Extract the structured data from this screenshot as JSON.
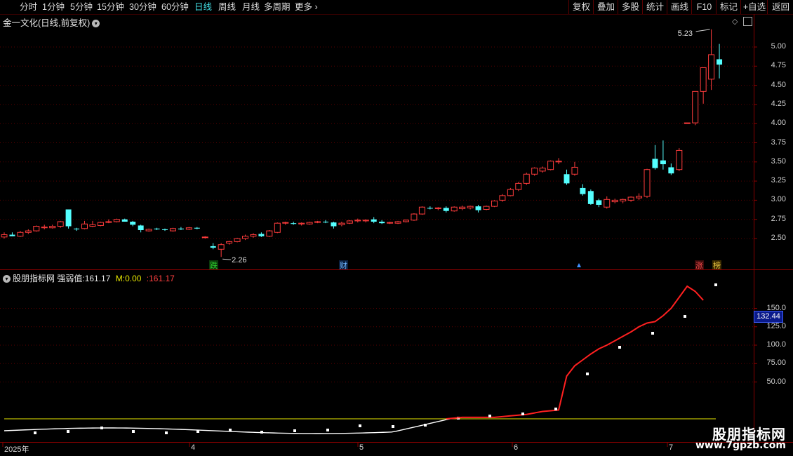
{
  "toolbar": {
    "periods": [
      "分时",
      "1分钟",
      "5分钟",
      "15分钟",
      "30分钟",
      "60分钟",
      "日线",
      "周线",
      "月线",
      "多周期",
      "更多"
    ],
    "active_period": "日线",
    "right_buttons": [
      "复权",
      "叠加",
      "多股",
      "统计",
      "画线",
      "F10",
      "标记",
      "+自选",
      "返回"
    ]
  },
  "chart_title": "金一文化(日线,前复权)",
  "main_yaxis": [
    "5.00",
    "4.75",
    "4.50",
    "4.25",
    "4.00",
    "3.75",
    "3.50",
    "3.25",
    "3.00",
    "2.75",
    "2.50"
  ],
  "high_label": "5.23",
  "low_label": "2.26",
  "markers": [
    {
      "text": "跌",
      "color": "#2fd12f",
      "bg": "#0b3a0b"
    },
    {
      "text": "财",
      "color": "#6fb5ff",
      "bg": "#0a2040"
    },
    {
      "text": "涨",
      "color": "#ff5050",
      "bg": "#3a0a0a"
    },
    {
      "text": "榜",
      "color": "#e6c040",
      "bg": "#3a2a00"
    }
  ],
  "indicator": {
    "name": "股朋指标网",
    "label": "强弱值:",
    "value": "161.17",
    "m_label": "M:",
    "m_value": "0.00",
    "extra": ":161.17",
    "yaxis": [
      "150.0",
      "125.0",
      "100.0",
      "75.00",
      "50.00"
    ],
    "badge": "132.44"
  },
  "xaxis": [
    "2025年",
    "4",
    "5",
    "6",
    "7"
  ],
  "watermark": {
    "line1": "股朋指标网",
    "line2": "www.7gpzb.com"
  },
  "colors": {
    "up": "#ff3c3c",
    "down": "#54ffff",
    "line": "#ff2020",
    "white_line": "#ffffff",
    "zero": "#e8e800"
  },
  "chart_data": {
    "type": "candlestick",
    "ohlc": [
      [
        2.52,
        2.58,
        2.5,
        2.55
      ],
      [
        2.55,
        2.58,
        2.53,
        2.53
      ],
      [
        2.53,
        2.6,
        2.52,
        2.58
      ],
      [
        2.58,
        2.62,
        2.56,
        2.6
      ],
      [
        2.6,
        2.67,
        2.59,
        2.66
      ],
      [
        2.64,
        2.68,
        2.62,
        2.65
      ],
      [
        2.64,
        2.68,
        2.63,
        2.66
      ],
      [
        2.66,
        2.73,
        2.64,
        2.72
      ],
      [
        2.88,
        2.88,
        2.63,
        2.66
      ],
      [
        2.63,
        2.64,
        2.6,
        2.62
      ],
      [
        2.63,
        2.73,
        2.62,
        2.69
      ],
      [
        2.66,
        2.73,
        2.65,
        2.68
      ],
      [
        2.67,
        2.72,
        2.66,
        2.71
      ],
      [
        2.71,
        2.75,
        2.7,
        2.72
      ],
      [
        2.72,
        2.76,
        2.71,
        2.75
      ],
      [
        2.75,
        2.76,
        2.72,
        2.72
      ],
      [
        2.72,
        2.73,
        2.66,
        2.68
      ],
      [
        2.67,
        2.68,
        2.58,
        2.61
      ],
      [
        2.6,
        2.63,
        2.59,
        2.62
      ],
      [
        2.63,
        2.64,
        2.61,
        2.62
      ],
      [
        2.62,
        2.63,
        2.6,
        2.61
      ],
      [
        2.6,
        2.64,
        2.59,
        2.63
      ],
      [
        2.63,
        2.65,
        2.61,
        2.62
      ],
      [
        2.62,
        2.65,
        2.61,
        2.64
      ],
      [
        2.64,
        2.65,
        2.62,
        2.63
      ],
      [
        2.52,
        2.53,
        2.5,
        2.52
      ],
      [
        2.4,
        2.44,
        2.36,
        2.38
      ],
      [
        2.36,
        2.44,
        2.26,
        2.42
      ],
      [
        2.44,
        2.47,
        2.42,
        2.46
      ],
      [
        2.46,
        2.51,
        2.45,
        2.5
      ],
      [
        2.5,
        2.55,
        2.48,
        2.53
      ],
      [
        2.53,
        2.57,
        2.51,
        2.55
      ],
      [
        2.56,
        2.58,
        2.52,
        2.53
      ],
      [
        2.53,
        2.61,
        2.52,
        2.6
      ],
      [
        2.58,
        2.71,
        2.57,
        2.7
      ],
      [
        2.7,
        2.72,
        2.68,
        2.71
      ],
      [
        2.7,
        2.72,
        2.68,
        2.69
      ],
      [
        2.69,
        2.71,
        2.67,
        2.7
      ],
      [
        2.69,
        2.72,
        2.68,
        2.71
      ],
      [
        2.71,
        2.73,
        2.7,
        2.72
      ],
      [
        2.72,
        2.74,
        2.7,
        2.71
      ],
      [
        2.71,
        2.72,
        2.63,
        2.66
      ],
      [
        2.68,
        2.72,
        2.66,
        2.7
      ],
      [
        2.7,
        2.74,
        2.69,
        2.73
      ],
      [
        2.73,
        2.76,
        2.71,
        2.74
      ],
      [
        2.73,
        2.75,
        2.71,
        2.74
      ],
      [
        2.75,
        2.78,
        2.7,
        2.72
      ],
      [
        2.72,
        2.74,
        2.69,
        2.7
      ],
      [
        2.7,
        2.72,
        2.69,
        2.71
      ],
      [
        2.7,
        2.73,
        2.69,
        2.72
      ],
      [
        2.72,
        2.75,
        2.71,
        2.74
      ],
      [
        2.74,
        2.83,
        2.73,
        2.82
      ],
      [
        2.82,
        2.92,
        2.81,
        2.91
      ],
      [
        2.9,
        2.92,
        2.88,
        2.89
      ],
      [
        2.89,
        2.91,
        2.87,
        2.9
      ],
      [
        2.9,
        2.92,
        2.84,
        2.86
      ],
      [
        2.86,
        2.92,
        2.85,
        2.91
      ],
      [
        2.89,
        2.93,
        2.87,
        2.91
      ],
      [
        2.9,
        2.93,
        2.88,
        2.92
      ],
      [
        2.92,
        2.94,
        2.84,
        2.87
      ],
      [
        2.88,
        2.93,
        2.87,
        2.92
      ],
      [
        2.92,
        3.0,
        2.91,
        2.99
      ],
      [
        3.0,
        3.08,
        2.98,
        3.06
      ],
      [
        3.06,
        3.16,
        3.05,
        3.14
      ],
      [
        3.14,
        3.24,
        3.12,
        3.22
      ],
      [
        3.22,
        3.36,
        3.2,
        3.34
      ],
      [
        3.34,
        3.43,
        3.32,
        3.42
      ],
      [
        3.38,
        3.44,
        3.36,
        3.42
      ],
      [
        3.4,
        3.52,
        3.39,
        3.51
      ],
      [
        3.5,
        3.55,
        3.47,
        3.51
      ],
      [
        3.34,
        3.4,
        3.2,
        3.22
      ],
      [
        3.34,
        3.5,
        3.32,
        3.43
      ],
      [
        3.16,
        3.21,
        3.06,
        3.08
      ],
      [
        3.12,
        3.14,
        2.94,
        2.95
      ],
      [
        3.0,
        3.02,
        2.91,
        2.94
      ],
      [
        2.91,
        3.05,
        2.89,
        3.01
      ],
      [
        2.98,
        3.02,
        2.96,
        3.0
      ],
      [
        2.99,
        3.02,
        2.96,
        3.01
      ],
      [
        3.0,
        3.05,
        2.98,
        3.04
      ],
      [
        3.03,
        3.09,
        3.0,
        3.05
      ],
      [
        3.05,
        3.41,
        3.03,
        3.4
      ],
      [
        3.54,
        3.72,
        3.4,
        3.42
      ],
      [
        3.52,
        3.78,
        3.4,
        3.47
      ],
      [
        3.43,
        3.48,
        3.33,
        3.35
      ],
      [
        3.4,
        3.68,
        3.38,
        3.65
      ],
      [
        4.01,
        4.01,
        4.01,
        4.01
      ],
      [
        4.01,
        4.42,
        3.98,
        4.42
      ],
      [
        4.42,
        4.73,
        4.26,
        4.73
      ],
      [
        4.58,
        5.23,
        4.44,
        4.9
      ],
      [
        4.84,
        5.04,
        4.59,
        4.77
      ]
    ],
    "ylim": [
      2.2,
      5.25
    ],
    "indicator_series": [
      {
        "name": "强弱值",
        "values": [
          0,
          0,
          0,
          0,
          0,
          0,
          0,
          0,
          0,
          0,
          0,
          0,
          0,
          0,
          0,
          0,
          0,
          0,
          0,
          0,
          0,
          0,
          0,
          0,
          0,
          0,
          0,
          0,
          0,
          0,
          0,
          0,
          0,
          0,
          0,
          0,
          0,
          0,
          0,
          0,
          0,
          0,
          0,
          0,
          0,
          0,
          0,
          0,
          0,
          0,
          0,
          0,
          0,
          0,
          0,
          0,
          1,
          2,
          2,
          2,
          2,
          2,
          3,
          4,
          5,
          6,
          8,
          10,
          11,
          12,
          58,
          72,
          80,
          88,
          95,
          100,
          106,
          112,
          118,
          125,
          130,
          132,
          140,
          150,
          165,
          180,
          173,
          161
        ]
      }
    ]
  }
}
